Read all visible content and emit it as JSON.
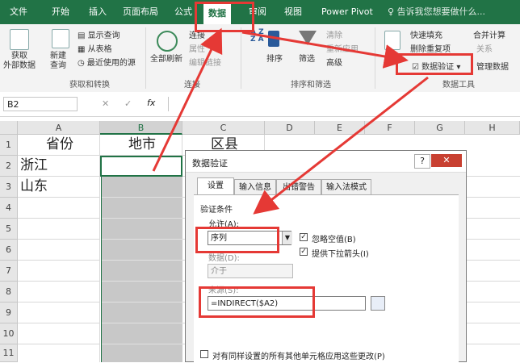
{
  "tabs": [
    "文件",
    "开始",
    "插入",
    "页面布局",
    "公式",
    "数据",
    "审阅",
    "视图",
    "Power Pivot"
  ],
  "tell_me": "告诉我您想要做什么...",
  "ribbon": {
    "get_external": "获取\n外部数据",
    "new_query": "新建\n查询",
    "show_query": "显示查询",
    "from_table": "从表格",
    "recent_sources": "最近使用的源",
    "group_get_transform": "获取和转换",
    "refresh_all": "全部刷新",
    "connections": "连接",
    "properties": "属性",
    "edit_links": "编辑链接",
    "group_connections": "连接",
    "sort": "排序",
    "filter": "筛选",
    "clear": "清除",
    "reapply": "重新应用",
    "advanced": "高级",
    "group_sort_filter": "排序和筛选",
    "split": "分列",
    "flash_fill": "快速填充",
    "remove_dup": "删除重复项",
    "data_validation": "数据验证",
    "consolidate": "合并计算",
    "relationships": "关系",
    "manage_model": "管理数据",
    "group_data_tools": "数据工具"
  },
  "formula_bar": {
    "name_box": "B2",
    "cancel": "✕",
    "enter": "✓",
    "fx": "fx"
  },
  "columns": [
    "A",
    "B",
    "C",
    "D",
    "E",
    "F",
    "G",
    "H"
  ],
  "rows": [
    "1",
    "2",
    "3",
    "4",
    "5",
    "6",
    "7",
    "8",
    "9",
    "10",
    "11"
  ],
  "cells": {
    "A1": "省份",
    "B1": "地市",
    "C1": "区县",
    "A2": "浙江",
    "A3": "山东"
  },
  "dialog": {
    "title": "数据验证",
    "help": "?",
    "close": "✕",
    "tabs": [
      "设置",
      "输入信息",
      "出错警告",
      "输入法模式"
    ],
    "criteria_label": "验证条件",
    "allow_label": "允许(A):",
    "allow_value": "序列",
    "ignore_blank": "忽略空值(B)",
    "dropdown": "提供下拉箭头(I)",
    "data_label": "数据(D):",
    "data_value": "介于",
    "source_label": "来源(S):",
    "source_value": "=INDIRECT($A2)",
    "apply_all": "对有同样设置的所有其他单元格应用这些更改(P)"
  },
  "colors": {
    "excel_green": "#217346",
    "highlight_red": "#e53935",
    "gray_fill": "#c8c8c8"
  }
}
